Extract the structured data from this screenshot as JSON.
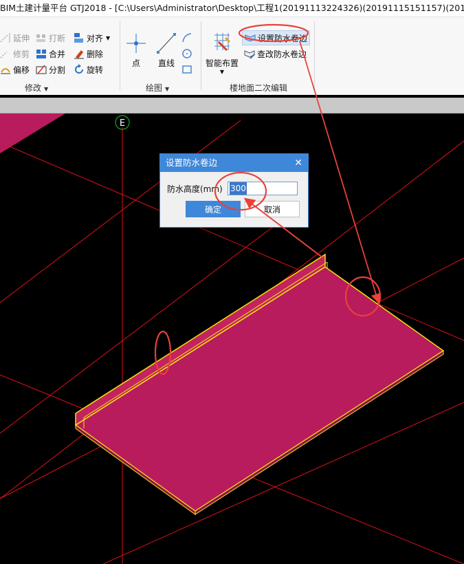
{
  "window": {
    "title": "BIM土建计量平台 GTJ2018 - [C:\\Users\\Administrator\\Desktop\\工程1(20191113224326)(20191115151157)(20191115214"
  },
  "ribbon": {
    "modify_group": {
      "label": "修改",
      "extend_label": "延伸",
      "trim_label": "修剪",
      "offset_label": "偏移",
      "break_label": "打断",
      "merge_label": "合并",
      "split_label": "分割",
      "align_label": "对齐",
      "delete_label": "删除",
      "rotate_label": "旋转"
    },
    "draw_group": {
      "label": "绘图",
      "point_label": "点",
      "line_label": "直线"
    },
    "floor_group": {
      "label": "楼地面二次编辑",
      "smart_layout_label": "智能布置",
      "set_waterproof_edge_label": "设置防水卷边",
      "check_waterproof_edge_label": "查改防水卷边"
    }
  },
  "viewport": {
    "axis_label": "E"
  },
  "dialog": {
    "title": "设置防水卷边",
    "field_label": "防水高度(mm)",
    "field_value": "300",
    "ok_label": "确定",
    "cancel_label": "取消"
  },
  "colors": {
    "slab_fill": "#b81c5c",
    "slab_edge": "#f2e60c",
    "grid_line": "#e0101b",
    "annotation": "#e8423a",
    "dialog_accent": "#3f87d8"
  }
}
